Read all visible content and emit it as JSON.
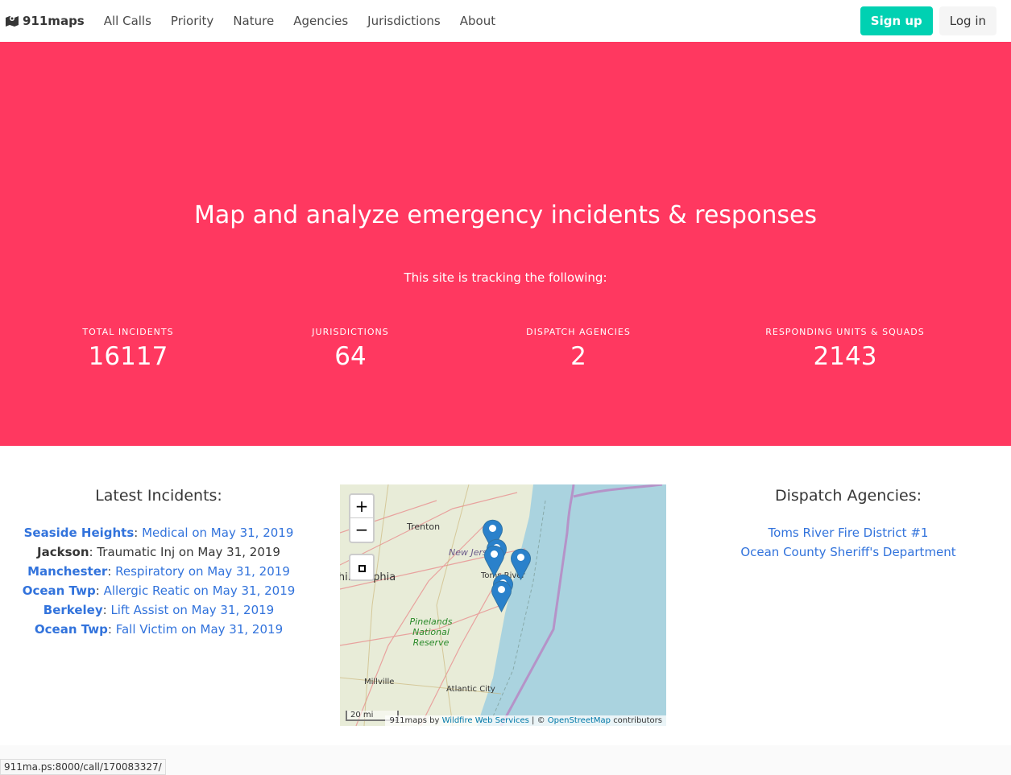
{
  "nav": {
    "brand": "911maps",
    "links": [
      "All Calls",
      "Priority",
      "Nature",
      "Agencies",
      "Jurisdictions",
      "About"
    ],
    "signup": "Sign up",
    "login": "Log in"
  },
  "hero": {
    "title": "Map and analyze emergency incidents & responses",
    "subtitle": "This site is tracking the following:",
    "stats": [
      {
        "label": "TOTAL INCIDENTS",
        "value": "16117"
      },
      {
        "label": "JURISDICTIONS",
        "value": "64"
      },
      {
        "label": "DISPATCH AGENCIES",
        "value": "2"
      },
      {
        "label": "RESPONDING UNITS & SQUADS",
        "value": "2143"
      }
    ]
  },
  "latest": {
    "title": "Latest Incidents:",
    "items": [
      {
        "jurisdiction": "Seaside Heights",
        "nature": "Medical",
        "date": "on May 31, 2019"
      },
      {
        "jurisdiction": "Jackson",
        "nature": "Traumatic Inj",
        "date": "on May 31, 2019"
      },
      {
        "jurisdiction": "Manchester",
        "nature": "Respiratory",
        "date": "on May 31, 2019"
      },
      {
        "jurisdiction": "Ocean Twp",
        "nature": "Allergic Reatic",
        "date": "on May 31, 2019"
      },
      {
        "jurisdiction": "Berkeley",
        "nature": "Lift Assist",
        "date": "on May 31, 2019"
      },
      {
        "jurisdiction": "Ocean Twp",
        "nature": "Fall Victim",
        "date": "on May 31, 2019"
      }
    ]
  },
  "map": {
    "zoom_in": "+",
    "zoom_out": "−",
    "scale": "20 mi",
    "labels": [
      "Trenton",
      "New Jersey",
      "Philadelphia",
      "Toms River",
      "Pinelands National Reserve",
      "Millville",
      "Atlantic City"
    ],
    "attribution": {
      "prefix": "911maps by",
      "link1": "Wildfire Web Services",
      "sep": "| ©",
      "link2": "OpenStreetMap",
      "suffix": "contributors"
    }
  },
  "agencies": {
    "title": "Dispatch Agencies:",
    "items": [
      "Toms River Fire District #1",
      "Ocean County Sheriff's Department"
    ]
  },
  "status_url": "911ma.ps:8000/call/170083327/",
  "colors": {
    "hero": "#ff3860",
    "primary": "#00d1b2",
    "link": "#3273dc"
  }
}
